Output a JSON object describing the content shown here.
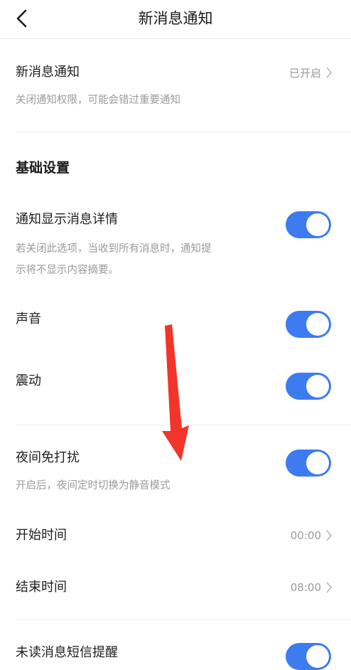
{
  "header": {
    "title": "新消息通知",
    "back_icon": "chevron-left-icon"
  },
  "notification": {
    "title": "新消息通知",
    "status": "已开启",
    "desc": "关闭通知权限，可能会错过重要通知"
  },
  "basic": {
    "section_title": "基础设置",
    "show_details": {
      "title": "通知显示消息详情",
      "desc_line1": "若关闭此选项，当收到所有消息时，通知提",
      "desc_line2": "示将不显示内容摘要。",
      "enabled": true
    },
    "sound": {
      "title": "声音",
      "enabled": true
    },
    "vibrate": {
      "title": "震动",
      "enabled": true
    }
  },
  "night": {
    "title": "夜间免打扰",
    "desc": "开启后，夜间定时切换为静音模式",
    "enabled": true,
    "start": {
      "title": "开始时间",
      "value": "00:00"
    },
    "end": {
      "title": "结束时间",
      "value": "08:00"
    }
  },
  "sms": {
    "title": "未读消息短信提醒",
    "enabled": true
  },
  "colors": {
    "accent": "#3d7bf0",
    "annotation_arrow": "#f2342b"
  }
}
